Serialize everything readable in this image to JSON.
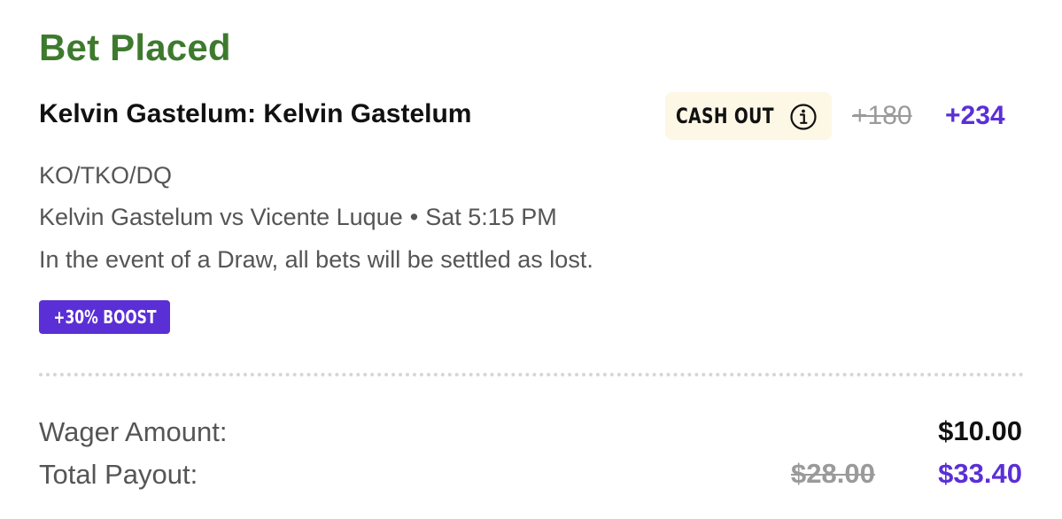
{
  "header": {
    "status": "Bet Placed"
  },
  "bet": {
    "title": "Kelvin Gastelum: Kelvin Gastelum",
    "market": "KO/TKO/DQ",
    "matchup": "Kelvin Gastelum vs Vicente Luque",
    "separator": "•",
    "start_time": "Sat 5:15 PM",
    "rule_note": "In the event of a Draw, all bets will be settled as lost.",
    "boost_label": "+30% BOOST",
    "odds_original": "+180",
    "odds_boosted": "+234"
  },
  "cashout": {
    "label": "CASH OUT",
    "icon": "info-icon"
  },
  "summary": {
    "wager_label": "Wager Amount:",
    "wager_value": "$10.00",
    "payout_label": "Total Payout:",
    "payout_original": "$28.00",
    "payout_boosted": "$33.40"
  },
  "colors": {
    "status_green": "#3e7a2e",
    "accent_purple": "#5a2fd6",
    "cashout_bg": "#fdf7e6",
    "strikethrough_gray": "#9a9a9a"
  }
}
